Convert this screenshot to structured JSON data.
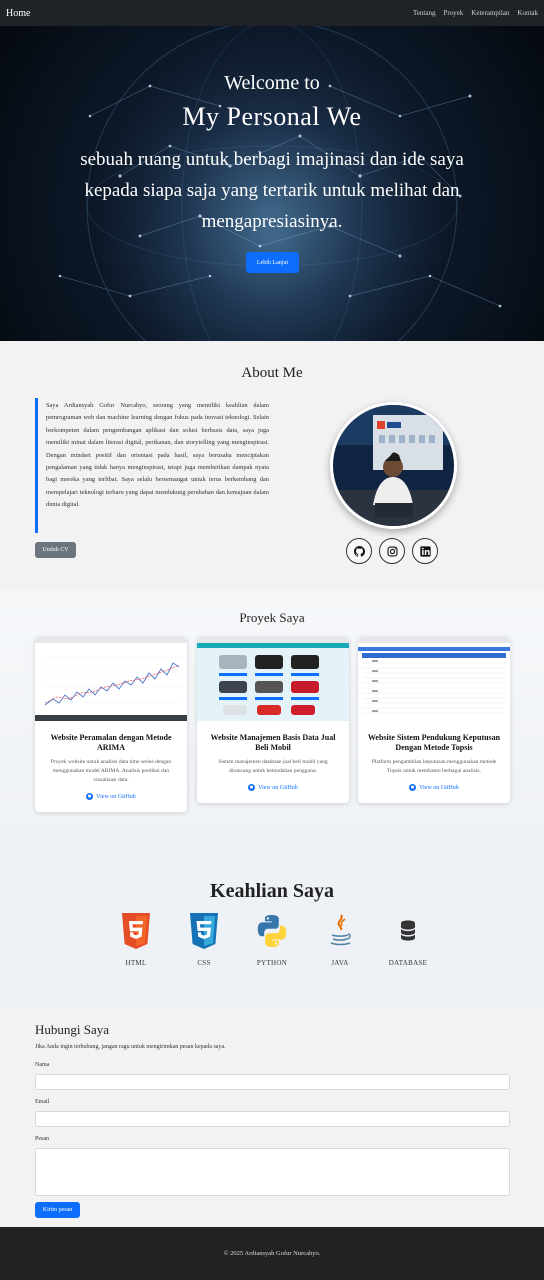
{
  "navbar": {
    "brand": "Home",
    "links": [
      "Tentang",
      "Proyek",
      "Keterampilan",
      "Kontak"
    ]
  },
  "hero": {
    "welcome": "Welcome to",
    "title": "My Personal We",
    "tagline": "sebuah ruang untuk berbagi imajinasi dan ide saya kepada siapa saja yang tertarik untuk melihat dan mengapresiasinya.",
    "cta": "Lebih Lanjut"
  },
  "about": {
    "title": "About Me",
    "bio": "Saya Ardiansyah Gofur Nurcahyo, seorang yang memiliki keahlian dalam pemrograman web dan machine learning dengan fokus pada inovasi teknologi. Selain berkompeten dalam pengembangan aplikasi dan solusi berbasis data, saya juga memiliki minat dalam literasi digital, perikanan, dan storytelling yang menginspirasi. Dengan mindset positif dan orientasi pada hasil, saya berusaha menciptakan pengalaman yang tidak hanya menginspirasi, tetapi juga memberikan dampak nyata bagi mereka yang terlibat. Saya selalu bersemangat untuk terus berkembang dan mempelajari teknologi terbaru yang dapat mendukung perubahan dan kemajuan dalam dunia digital.",
    "cv_button": "Unduh CV",
    "social_icons": [
      "github-icon",
      "instagram-icon",
      "linkedin-icon"
    ]
  },
  "projects": {
    "title": "Proyek Saya",
    "items": [
      {
        "title": "Website Peramalan dengan Metode ARIMA",
        "desc": "Proyek website untuk analisis data time series dengan menggunakan model ARIMA. Analisis prediksi dan visualisasi data.",
        "link": "View on GitHub"
      },
      {
        "title": "Website Manajemen Basis Data Jual Beli Mobil",
        "desc": "Sistem manajemen database jual beli mobil yang dirancang untuk kemudahan pengguna.",
        "link": "View on GitHub"
      },
      {
        "title": "Website Sistem Pendukung Keputusan Dengan Metode Topsis",
        "desc": "Platform pengambilan keputusan menggunakan metode Topsis untuk membantu berbagai analisis.",
        "link": "View on GitHub"
      }
    ]
  },
  "skills": {
    "title": "Keahlian Saya",
    "items": [
      {
        "label": "HTML",
        "icon": "html5-icon"
      },
      {
        "label": "CSS",
        "icon": "css3-icon"
      },
      {
        "label": "PYTHON",
        "icon": "python-icon"
      },
      {
        "label": "JAVA",
        "icon": "java-icon"
      },
      {
        "label": "DATABASE",
        "icon": "database-icon"
      }
    ]
  },
  "contact": {
    "title": "Hubungi Saya",
    "subtitle": "Jika Anda ingin terhubung, jangan ragu untuk mengirimkan pesan kepada saya.",
    "name_label": "Nama",
    "email_label": "Email",
    "message_label": "Pesan",
    "submit": "Kirim pesan"
  },
  "footer": {
    "text": "© 2025 Ardiansyah Gofur Nurcahyo."
  },
  "colors": {
    "accent": "#0d6efd",
    "navbar": "#1f2226",
    "footer": "#222222"
  }
}
